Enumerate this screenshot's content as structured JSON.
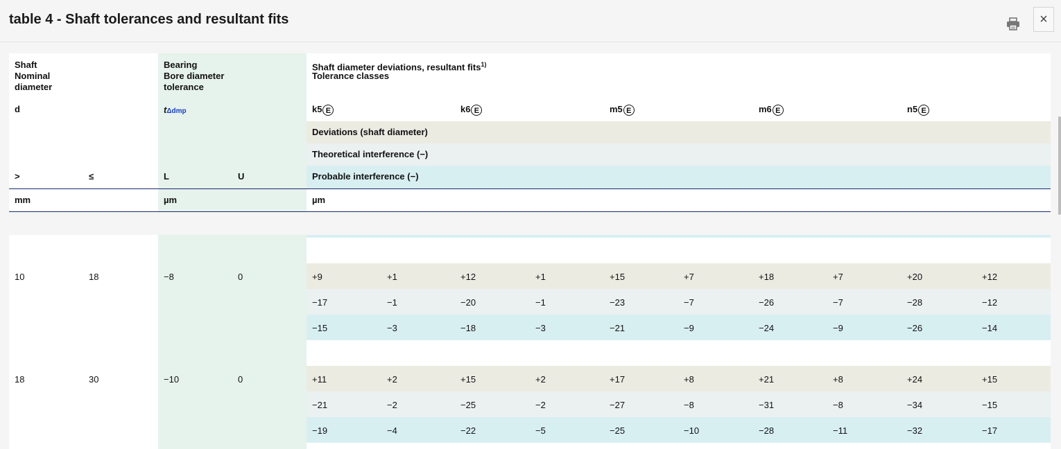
{
  "header": {
    "title": "table 4 - Shaft tolerances and resultant fits"
  },
  "icons": {
    "print": "printer-icon",
    "close": "close-icon",
    "close_glyph": "×"
  },
  "table": {
    "shaft_label": "Shaft",
    "nominal_label": "Nominal",
    "diameter_label": "diameter",
    "d_label": "d",
    "bearing_label": "Bearing",
    "bore_label": "Bore diameter",
    "tolerance_label": "tolerance",
    "t_symbol": "t",
    "t_sub": "Δdmp",
    "dev_header": "Shaft diameter deviations, resultant fits",
    "dev_header_sup": "1)",
    "tolerance_classes": "Tolerance classes",
    "classes": [
      "k5",
      "k6",
      "m5",
      "m6",
      "n5"
    ],
    "class_mark": "E",
    "deviations_label": "Deviations (shaft diameter)",
    "theoretical_label": "Theoretical interference (−)",
    "probable_label": "Probable interference (−)",
    "gt": ">",
    "le": "≤",
    "L": "L",
    "U": "U",
    "unit_mm": "mm",
    "unit_um_bearing": "µm",
    "unit_um_dev": "µm"
  },
  "rows": [
    {
      "d_gt": "10",
      "d_le": "18",
      "L": "−8",
      "U": "0",
      "dev": [
        "+9",
        "+1",
        "+12",
        "+1",
        "+15",
        "+7",
        "+18",
        "+7",
        "+20",
        "+12"
      ],
      "theo": [
        "−17",
        "−1",
        "−20",
        "−1",
        "−23",
        "−7",
        "−26",
        "−7",
        "−28",
        "−12"
      ],
      "prob": [
        "−15",
        "−3",
        "−18",
        "−3",
        "−21",
        "−9",
        "−24",
        "−9",
        "−26",
        "−14"
      ]
    },
    {
      "d_gt": "18",
      "d_le": "30",
      "L": "−10",
      "U": "0",
      "dev": [
        "+11",
        "+2",
        "+15",
        "+2",
        "+17",
        "+8",
        "+21",
        "+8",
        "+24",
        "+15"
      ],
      "theo": [
        "−21",
        "−2",
        "−25",
        "−2",
        "−27",
        "−8",
        "−31",
        "−8",
        "−34",
        "−15"
      ],
      "prob": [
        "−19",
        "−4",
        "−22",
        "−5",
        "−25",
        "−10",
        "−28",
        "−11",
        "−32",
        "−17"
      ]
    }
  ]
}
